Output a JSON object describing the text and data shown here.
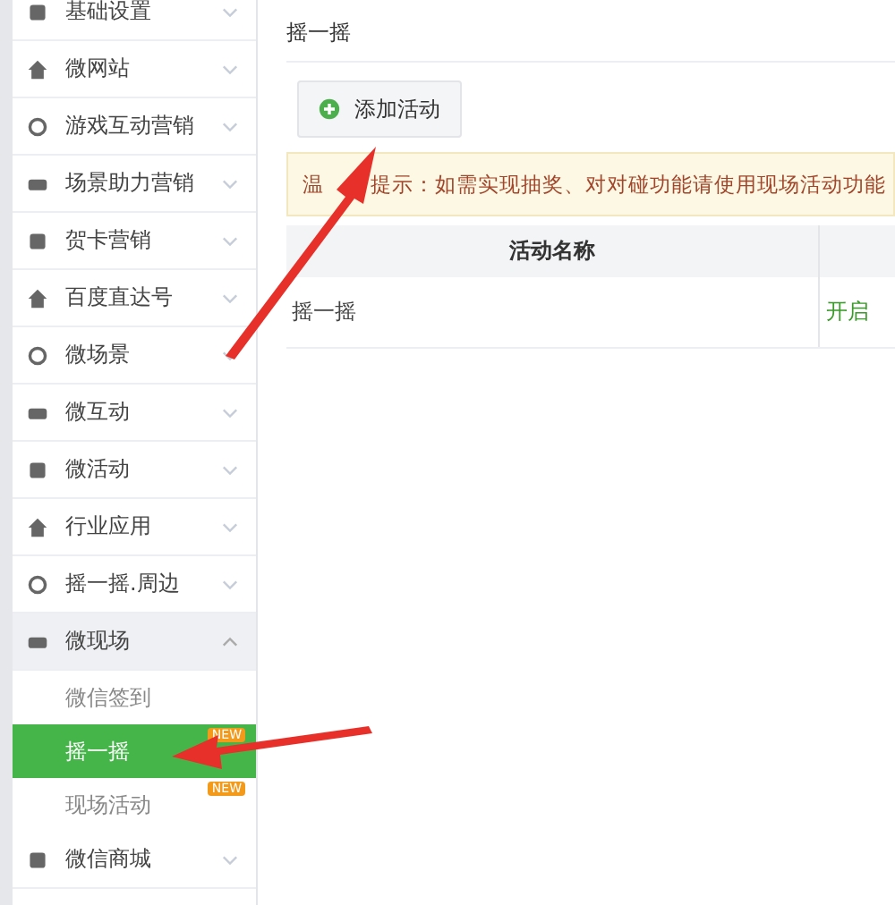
{
  "sidebar": {
    "items": [
      {
        "label": "基础设置",
        "expanded": false
      },
      {
        "label": "微网站",
        "expanded": false
      },
      {
        "label": "游戏互动营销",
        "expanded": false
      },
      {
        "label": "场景助力营销",
        "expanded": false
      },
      {
        "label": "贺卡营销",
        "expanded": false
      },
      {
        "label": "百度直达号",
        "expanded": false
      },
      {
        "label": "微场景",
        "expanded": false
      },
      {
        "label": "微互动",
        "expanded": false
      },
      {
        "label": "微活动",
        "expanded": false
      },
      {
        "label": "行业应用",
        "expanded": false
      },
      {
        "label": "摇一摇.周边",
        "expanded": false
      },
      {
        "label": "微现场",
        "expanded": true,
        "children": [
          {
            "label": "微信签到",
            "selected": false
          },
          {
            "label": "摇一摇",
            "selected": true,
            "badge": "NEW"
          },
          {
            "label": "现场活动",
            "selected": false,
            "badge": "NEW"
          }
        ]
      },
      {
        "label": "微信商城",
        "expanded": false
      }
    ]
  },
  "page": {
    "title": "摇一摇",
    "add_button": "添加活动",
    "tip": [
      "温",
      "提示：如需实现抽奖、对对碰功能请使用现场活动功能"
    ],
    "table": {
      "columns": [
        "活动名称"
      ],
      "rows": [
        [
          "摇一摇",
          "开启"
        ]
      ]
    }
  }
}
